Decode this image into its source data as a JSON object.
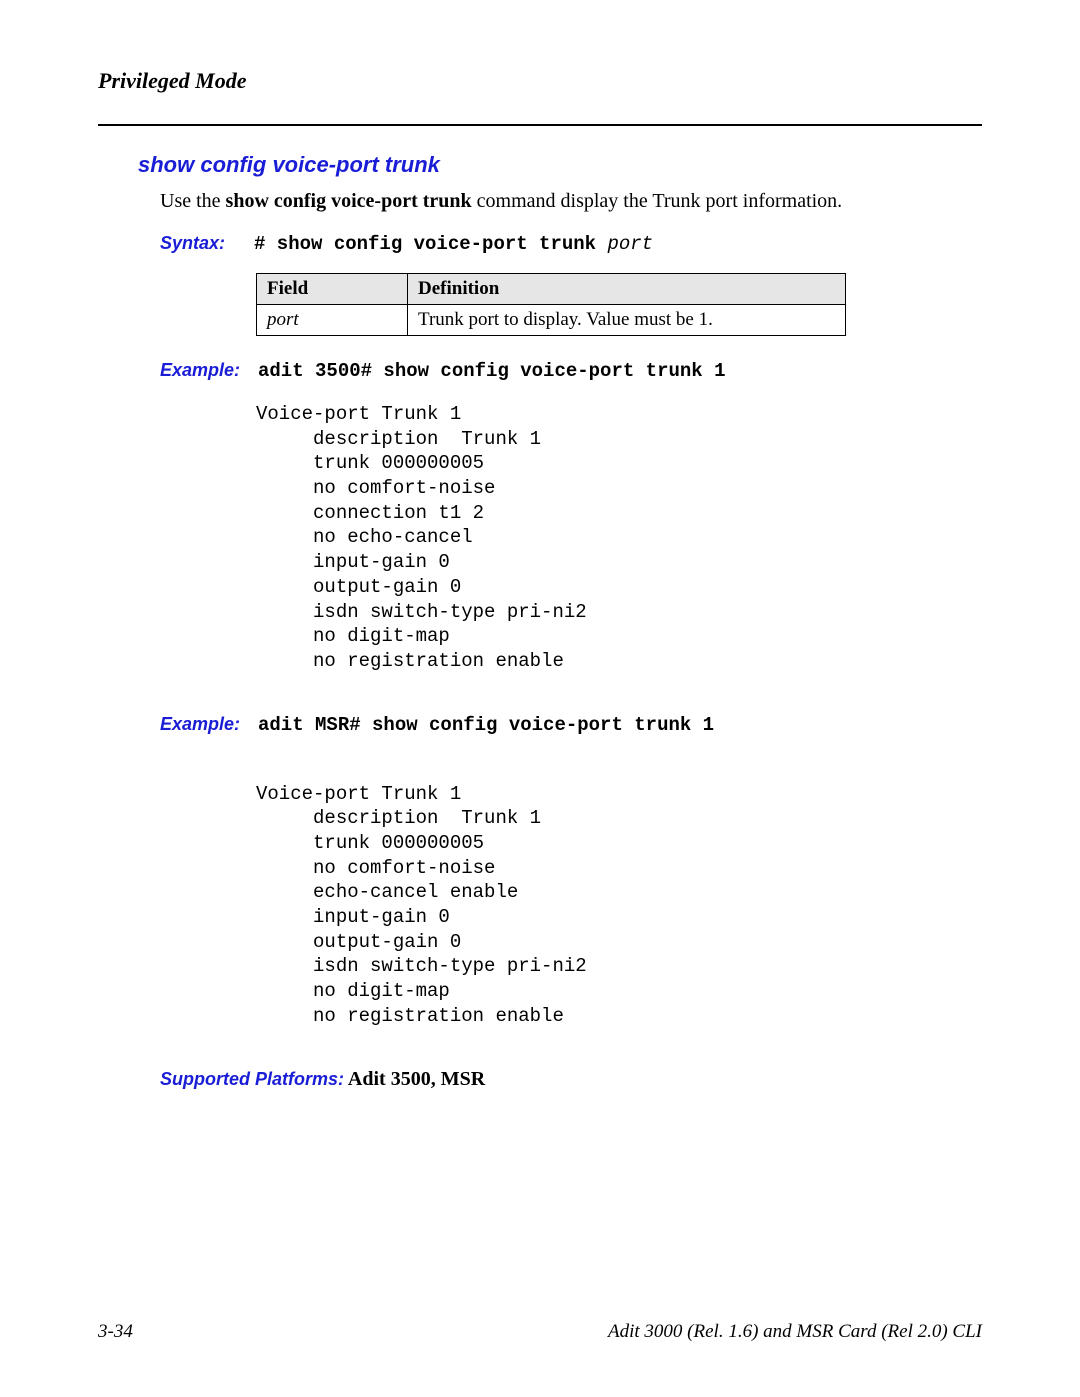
{
  "running_header": "Privileged Mode",
  "section_title": "show config voice-port trunk",
  "intro_pre": "Use the ",
  "intro_bold": "show config voice-port trunk",
  "intro_post": " command display the Trunk port information.",
  "labels": {
    "syntax": "Syntax:",
    "example": "Example:",
    "supported": "Supported Platforms:"
  },
  "syntax": {
    "cmd": "# show config voice-port trunk ",
    "param": "port"
  },
  "table": {
    "headers": {
      "field": "Field",
      "definition": "Definition"
    },
    "rows": [
      {
        "field": "port",
        "definition": "Trunk port to display.  Value must be 1."
      }
    ]
  },
  "example1": {
    "cmd": "adit 3500# show config voice-port trunk 1",
    "output": "Voice-port Trunk 1\n     description  Trunk 1\n     trunk 000000005\n     no comfort-noise\n     connection t1 2\n     no echo-cancel\n     input-gain 0\n     output-gain 0\n     isdn switch-type pri-ni2\n     no digit-map\n     no registration enable"
  },
  "example2": {
    "cmd": "adit MSR# show config voice-port trunk 1",
    "output": "Voice-port Trunk 1\n     description  Trunk 1\n     trunk 000000005\n     no comfort-noise\n     echo-cancel enable\n     input-gain 0\n     output-gain 0\n     isdn switch-type pri-ni2\n     no digit-map\n     no registration enable"
  },
  "supported_value": "  Adit 3500, MSR",
  "footer": {
    "page": "3-34",
    "doc": "Adit 3000 (Rel. 1.6) and MSR Card (Rel 2.0) CLI"
  }
}
